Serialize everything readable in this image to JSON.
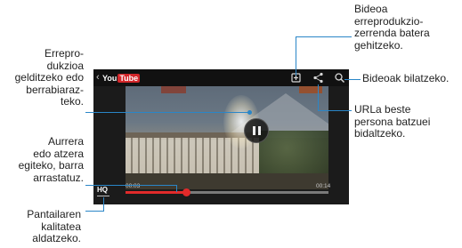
{
  "screen": {
    "logo_you": "You",
    "logo_tube": "Tube",
    "back_symbol": "‹",
    "time_elapsed": "00:03",
    "time_total": "00:14",
    "quality_label": "HQ",
    "seek_progress": 0.3
  },
  "icons": {
    "back": "chevron-left-icon",
    "playlist_add": "playlist-add-icon",
    "share": "share-icon",
    "search": "search-icon",
    "pause": "pause-icon"
  },
  "callouts": {
    "pause": [
      "Errepro-",
      "dukzioa",
      "gelditzeko edo",
      "berrabiaraz-",
      "teko."
    ],
    "seek": [
      "Aurrera",
      "edo atzera",
      "egiteko, barra",
      "arrastatuz."
    ],
    "quality": [
      "Pantailaren",
      "kalitatea",
      "aldatzeko."
    ],
    "playlist": [
      "Bideoa",
      "erreprodukzio-",
      "zerrenda batera",
      "gehitzeko."
    ],
    "search": [
      "Bideoak bilatzeko."
    ],
    "share": [
      "URLa beste",
      "persona batzuei",
      "bidaltzeko."
    ]
  },
  "colors": {
    "leader": "#2a86c8",
    "accent_red": "#e12a2a",
    "youtube_red": "#d3262a"
  }
}
